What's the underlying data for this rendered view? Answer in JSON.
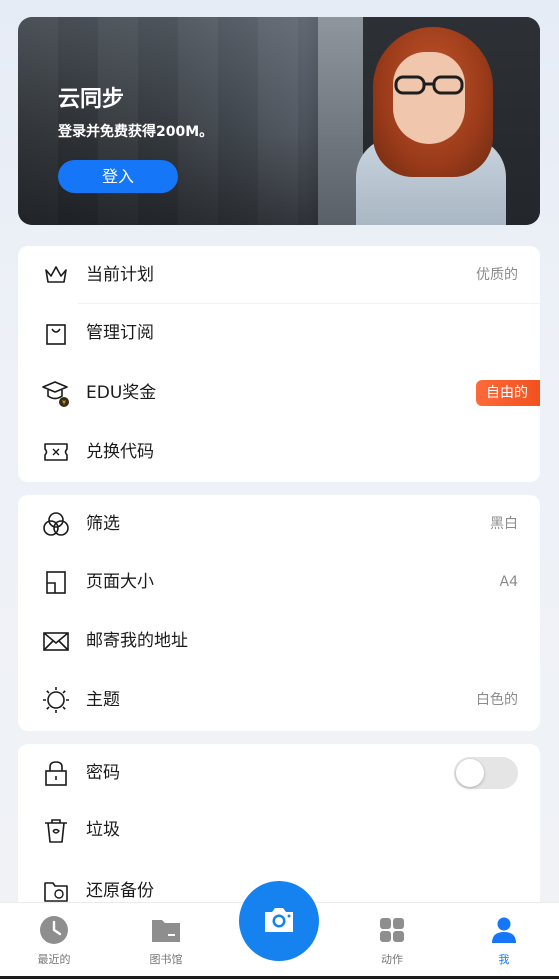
{
  "banner": {
    "title": "云同步",
    "subtitle": "登录并免费获得200M。",
    "login_label": "登入"
  },
  "account": {
    "items": [
      {
        "label": "当前计划",
        "value": "优质的",
        "icon": "crown-icon"
      },
      {
        "label": "管理订阅",
        "value": "",
        "icon": "shopping-bag-icon"
      },
      {
        "label": "EDU奖金",
        "badge": "自由的",
        "icon": "graduation-cap-icon"
      },
      {
        "label": "兑换代码",
        "value": "",
        "icon": "ticket-icon"
      }
    ]
  },
  "settings": {
    "items": [
      {
        "label": "筛选",
        "value": "黑白",
        "icon": "filter-icon"
      },
      {
        "label": "页面大小",
        "value": "A4",
        "icon": "page-size-icon"
      },
      {
        "label": "邮寄我的地址",
        "value": "",
        "icon": "mail-icon"
      },
      {
        "label": "主题",
        "value": "白色的",
        "icon": "sun-icon"
      }
    ]
  },
  "security": {
    "items": [
      {
        "label": "密码",
        "toggle": false,
        "icon": "lock-icon"
      },
      {
        "label": "垃圾",
        "icon": "trash-icon"
      },
      {
        "label": "还原备份",
        "icon": "folder-restore-icon"
      }
    ]
  },
  "nav": {
    "recent": "最近的",
    "library": "图书馆",
    "actions": "动作",
    "me": "我"
  },
  "colors": {
    "accent": "#1577f7",
    "badge": "#f2511f"
  }
}
